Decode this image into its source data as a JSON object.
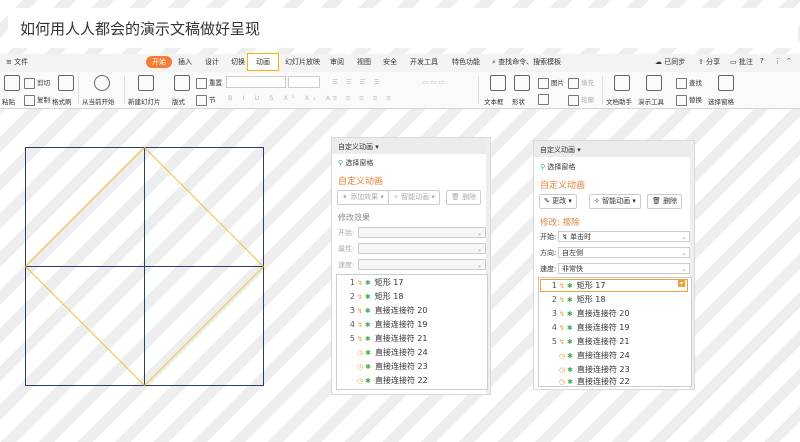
{
  "slide_title": "如何用人人都会的演示文稿做好呈现",
  "ribbon": {
    "tabs": [
      "文件",
      "开始",
      "插入",
      "设计",
      "切换",
      "动画",
      "幻灯片放映",
      "审阅",
      "视图",
      "安全",
      "开发工具",
      "特色功能"
    ],
    "search": "查找命令、搜索模板",
    "right": [
      "已同步",
      "分享",
      "批注"
    ],
    "tools": {
      "paste": "粘贴",
      "cut": "剪切",
      "copy": "复制",
      "format_painter": "格式刷",
      "from_current": "从当前开始",
      "new_slide": "新建幻灯片",
      "layout": "版式",
      "reset": "重置",
      "section": "节",
      "textbox": "文本框",
      "shape": "形状",
      "picture": "图片",
      "fill": "填充",
      "outline": "轮廓",
      "doc_helper": "文档助手",
      "presenter": "演示工具",
      "find": "查找",
      "replace": "替换",
      "select_pane": "选择窗格"
    }
  },
  "panel_left": {
    "title": "自定义动画",
    "select_pane": "选择窗格",
    "heading": "自定义动画",
    "add_effect": "添加效果",
    "smart_anim": "智能动画",
    "delete": "删除",
    "modify": "修改效果",
    "start_label": "开始:",
    "prop_label": "属性:",
    "speed_label": "速度:",
    "items": [
      {
        "num": "1",
        "name": "矩形 17"
      },
      {
        "num": "2",
        "name": "矩形 18"
      },
      {
        "num": "3",
        "name": "直接连接符 20"
      },
      {
        "num": "4",
        "name": "直接连接符 19"
      },
      {
        "num": "5",
        "name": "直接连接符 21"
      },
      {
        "num": "",
        "name": "直接连接符 24"
      },
      {
        "num": "",
        "name": "直接连接符 23"
      },
      {
        "num": "",
        "name": "直接连接符 22"
      }
    ]
  },
  "panel_right": {
    "title": "自定义动画",
    "select_pane": "选择窗格",
    "heading": "自定义动画",
    "change": "更改",
    "smart_anim": "智能动画",
    "delete": "删除",
    "modify": "修改: 擦除",
    "start_label": "开始:",
    "start_value": "单击时",
    "dir_label": "方向:",
    "dir_value": "自左侧",
    "speed_label": "速度:",
    "speed_value": "非常快",
    "items": [
      {
        "num": "1",
        "name": "矩形 17"
      },
      {
        "num": "2",
        "name": "矩形 18"
      },
      {
        "num": "3",
        "name": "直接连接符 20"
      },
      {
        "num": "4",
        "name": "直接连接符 19"
      },
      {
        "num": "5",
        "name": "直接连接符 21"
      },
      {
        "num": "",
        "name": "直接连接符 24"
      },
      {
        "num": "",
        "name": "直接连接符 23"
      },
      {
        "num": "",
        "name": "直接连接符 22"
      }
    ]
  },
  "colors": {
    "accent": "#f57c32",
    "diamond": "#f0c33c",
    "square": "#2c3e66"
  }
}
